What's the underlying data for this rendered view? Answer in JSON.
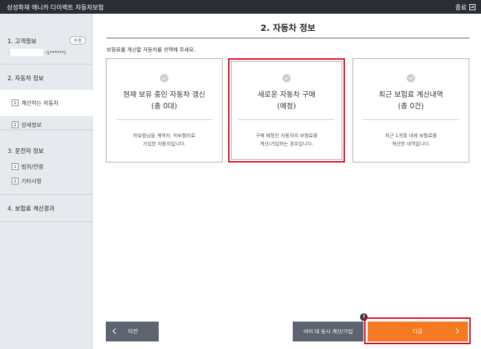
{
  "titlebar": {
    "title": "삼성화재 애니카 다이렉트 자동차보험",
    "close_label": "종료"
  },
  "sidebar": {
    "customer": {
      "heading": "1. 고객정보",
      "edit_label": "수정",
      "masked_prefix": "·",
      "masked_suffix": "-1******)"
    },
    "car": {
      "heading": "2. 자동차 정보",
      "items": [
        {
          "num": "1",
          "label": "계산하는 자동차"
        },
        {
          "num": "2",
          "label": "상세정보"
        }
      ]
    },
    "driver": {
      "heading": "3. 운전자 정보",
      "items": [
        {
          "num": "1",
          "label": "범위/연령"
        },
        {
          "num": "2",
          "label": "기타사항"
        }
      ]
    },
    "result": {
      "heading": "4. 보험료 계산결과"
    }
  },
  "main": {
    "title": "2. 자동차 정보",
    "instruction": "보험료를 계산할 자동차를 선택해 주세요.",
    "cards": [
      {
        "title1": "현재 보유 중인 자동차 갱신",
        "title2": "(총 0대)",
        "desc1": "허유범님을 계약자, 피보험자로",
        "desc2": "가입한 자동차입니다."
      },
      {
        "title1": "새로운 자동차 구매",
        "title2": "(예정)",
        "desc1": "구매 예정인 자동차의 보험료를",
        "desc2": "계산/가입하는 경우입니다."
      },
      {
        "title1": "최근 보험료 계산내역",
        "title2": "(총 0건)",
        "desc1": "최근 1개월 내에 보험료를",
        "desc2": "계산한 내역입니다."
      }
    ]
  },
  "buttons": {
    "prev": "이전",
    "multi": "여러 대 동시 계산/가입",
    "help": "?",
    "next": "다음"
  }
}
